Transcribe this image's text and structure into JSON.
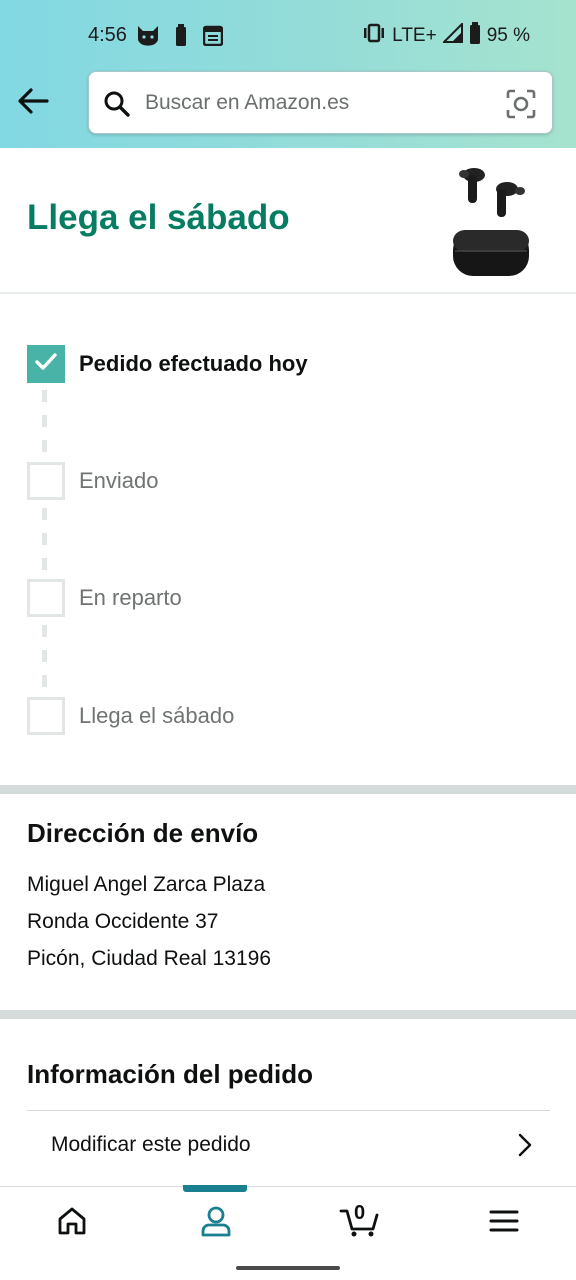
{
  "status_bar": {
    "time": "4:56",
    "network": "LTE+",
    "battery": "95 %"
  },
  "search": {
    "placeholder": "Buscar en Amazon.es"
  },
  "arrival": {
    "title": "Llega el sábado"
  },
  "tracking": {
    "steps": [
      {
        "label": "Pedido efectuado hoy",
        "done": true
      },
      {
        "label": "Enviado",
        "done": false
      },
      {
        "label": "En reparto",
        "done": false
      },
      {
        "label": "Llega el sábado",
        "done": false
      }
    ]
  },
  "shipping": {
    "title": "Dirección de envío",
    "lines": [
      "Miguel Angel Zarca Plaza",
      "Ronda Occidente 37",
      "Picón, Ciudad Real 13196"
    ]
  },
  "order_info": {
    "title": "Información del pedido",
    "modify_label": "Modificar este pedido"
  },
  "bottom_nav": {
    "cart_count": "0",
    "active": "account"
  },
  "colors": {
    "accent_teal": "#067d62",
    "check_teal": "#48b3a6",
    "nav_active": "#1a7f8e",
    "header_gradient": [
      "#82d8e3",
      "#a6e3cf"
    ]
  }
}
